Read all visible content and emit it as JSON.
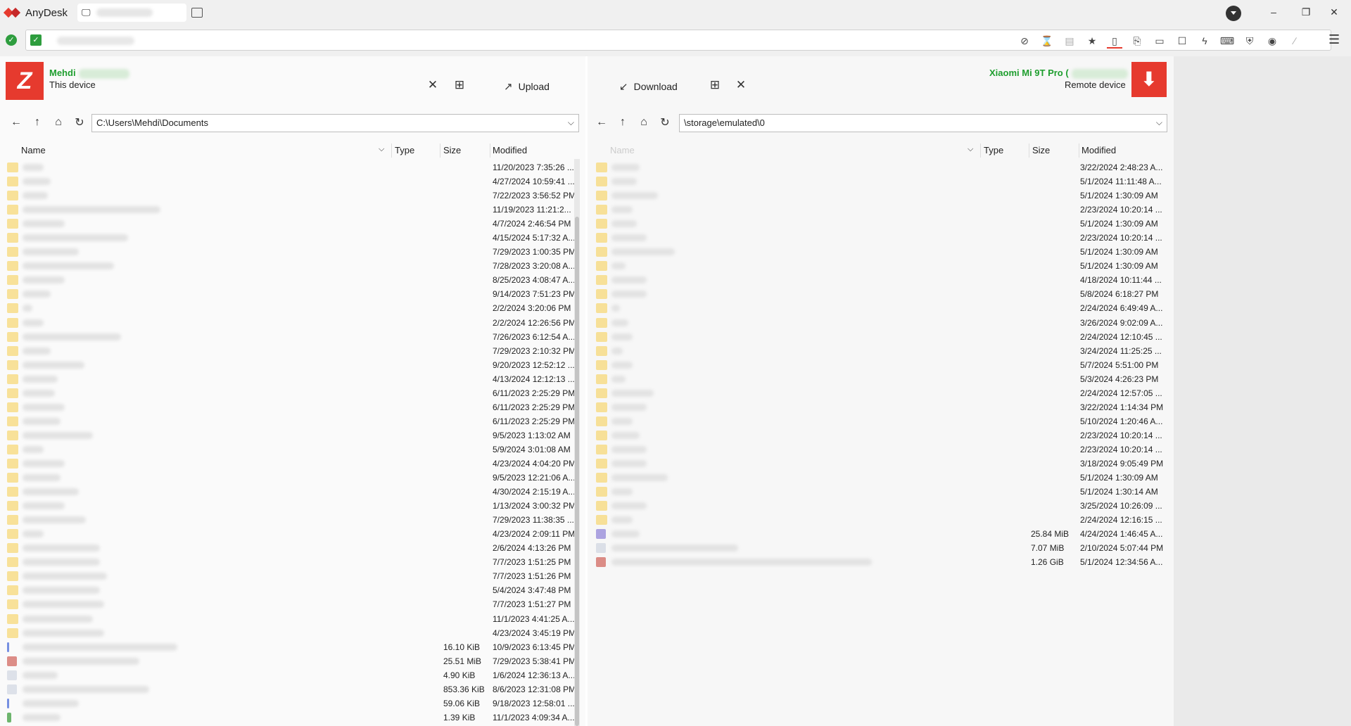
{
  "app": {
    "name": "AnyDesk"
  },
  "toolbar": {
    "icons": [
      "monitor-off-icon",
      "hourglass-icon",
      "database-icon",
      "star-icon",
      "file-transfer-icon",
      "clipboard-icon",
      "display-icon",
      "chat-icon",
      "lightning-icon",
      "keyboard-icon",
      "shield-icon",
      "record-icon",
      "pen-icon"
    ]
  },
  "local": {
    "name": "Mehdi",
    "subtitle": "This device",
    "upload_label": "Upload",
    "path": "C:\\Users\\Mehdi\\Documents",
    "columns": {
      "name": "Name",
      "type": "Type",
      "size": "Size",
      "modified": "Modified"
    },
    "rows": [
      {
        "w": 30,
        "size": "",
        "modified": "11/20/2023 7:35:26 ..."
      },
      {
        "w": 40,
        "size": "",
        "modified": "4/27/2024 10:59:41 ..."
      },
      {
        "w": 36,
        "size": "",
        "modified": "7/22/2023 3:56:52 PM"
      },
      {
        "w": 196,
        "size": "",
        "modified": "11/19/2023 11:21:2..."
      },
      {
        "w": 60,
        "size": "",
        "modified": "4/7/2024 2:46:54 PM"
      },
      {
        "w": 150,
        "size": "",
        "modified": "4/15/2024 5:17:32 A..."
      },
      {
        "w": 80,
        "size": "",
        "modified": "7/29/2023 1:00:35 PM"
      },
      {
        "w": 130,
        "size": "",
        "modified": "7/28/2023 3:20:08 A..."
      },
      {
        "w": 60,
        "size": "",
        "modified": "8/25/2023 4:08:47 A..."
      },
      {
        "w": 40,
        "size": "",
        "modified": "9/14/2023 7:51:23 PM"
      },
      {
        "w": 14,
        "size": "",
        "modified": "2/2/2024 3:20:06 PM"
      },
      {
        "w": 30,
        "size": "",
        "modified": "2/2/2024 12:26:56 PM"
      },
      {
        "w": 140,
        "size": "",
        "modified": "7/26/2023 6:12:54 A..."
      },
      {
        "w": 40,
        "size": "",
        "modified": "7/29/2023 2:10:32 PM"
      },
      {
        "w": 88,
        "size": "",
        "modified": "9/20/2023 12:52:12 ..."
      },
      {
        "w": 50,
        "size": "",
        "modified": "4/13/2024 12:12:13 ..."
      },
      {
        "w": 46,
        "size": "",
        "modified": "6/11/2023 2:25:29 PM"
      },
      {
        "w": 60,
        "size": "",
        "modified": "6/11/2023 2:25:29 PM"
      },
      {
        "w": 54,
        "size": "",
        "modified": "6/11/2023 2:25:29 PM"
      },
      {
        "w": 100,
        "size": "",
        "modified": "9/5/2023 1:13:02 AM"
      },
      {
        "w": 30,
        "size": "",
        "modified": "5/9/2024 3:01:08 AM"
      },
      {
        "w": 60,
        "size": "",
        "modified": "4/23/2024 4:04:20 PM"
      },
      {
        "w": 54,
        "size": "",
        "modified": "9/5/2023 12:21:06 A..."
      },
      {
        "w": 80,
        "size": "",
        "modified": "4/30/2024 2:15:19 A..."
      },
      {
        "w": 60,
        "size": "",
        "modified": "1/13/2024 3:00:32 PM"
      },
      {
        "w": 90,
        "size": "",
        "modified": "7/29/2023 11:38:35 ..."
      },
      {
        "w": 30,
        "size": "",
        "modified": "4/23/2024 2:09:11 PM"
      },
      {
        "w": 110,
        "size": "",
        "modified": "2/6/2024 4:13:26 PM"
      },
      {
        "w": 110,
        "size": "",
        "modified": "7/7/2023 1:51:25 PM"
      },
      {
        "w": 120,
        "size": "",
        "modified": "7/7/2023 1:51:26 PM"
      },
      {
        "w": 110,
        "size": "",
        "modified": "5/4/2024 3:47:48 PM"
      },
      {
        "w": 116,
        "size": "",
        "modified": "7/7/2023 1:51:27 PM"
      },
      {
        "w": 100,
        "size": "",
        "modified": "11/1/2023 4:41:25 A..."
      },
      {
        "w": 116,
        "size": "",
        "modified": "4/23/2024 3:45:19 PM"
      },
      {
        "w": 220,
        "file": "file",
        "size": "16.10 KiB",
        "modified": "10/9/2023 6:13:45 PM"
      },
      {
        "w": 166,
        "file": "red",
        "size": "25.51 MiB",
        "modified": "7/29/2023 5:38:41 PM"
      },
      {
        "w": 50,
        "file": "gray",
        "size": "4.90 KiB",
        "modified": "1/6/2024 12:36:13 A..."
      },
      {
        "w": 180,
        "file": "gray",
        "size": "853.36 KiB",
        "modified": "8/6/2023 12:31:08 PM"
      },
      {
        "w": 80,
        "file": "file",
        "size": "59.06 KiB",
        "modified": "9/18/2023 12:58:01 ..."
      },
      {
        "w": 54,
        "file": "green",
        "size": "1.39 KiB",
        "modified": "11/1/2023 4:09:34 A..."
      }
    ]
  },
  "remote": {
    "name": "Xiaomi Mi 9T Pro (",
    "subtitle": "Remote device",
    "download_label": "Download",
    "path": "\\storage\\emulated\\0",
    "columns": {
      "name": "Name",
      "type": "Type",
      "size": "Size",
      "modified": "Modified"
    },
    "rows": [
      {
        "w": 40,
        "size": "",
        "modified": "3/22/2024 2:48:23 A..."
      },
      {
        "w": 36,
        "size": "",
        "modified": "5/1/2024 11:11:48 A..."
      },
      {
        "w": 66,
        "size": "",
        "modified": "5/1/2024 1:30:09 AM"
      },
      {
        "w": 30,
        "size": "",
        "modified": "2/23/2024 10:20:14 ..."
      },
      {
        "w": 36,
        "size": "",
        "modified": "5/1/2024 1:30:09 AM"
      },
      {
        "w": 50,
        "size": "",
        "modified": "2/23/2024 10:20:14 ..."
      },
      {
        "w": 90,
        "size": "",
        "modified": "5/1/2024 1:30:09 AM"
      },
      {
        "w": 20,
        "size": "",
        "modified": "5/1/2024 1:30:09 AM"
      },
      {
        "w": 50,
        "size": "",
        "modified": "4/18/2024 10:11:44 ..."
      },
      {
        "w": 50,
        "size": "",
        "modified": "5/8/2024 6:18:27 PM"
      },
      {
        "w": 12,
        "size": "",
        "modified": "2/24/2024 6:49:49 A..."
      },
      {
        "w": 24,
        "size": "",
        "modified": "3/26/2024 9:02:09 A..."
      },
      {
        "w": 30,
        "size": "",
        "modified": "2/24/2024 12:10:45 ..."
      },
      {
        "w": 16,
        "size": "",
        "modified": "3/24/2024 11:25:25 ..."
      },
      {
        "w": 30,
        "size": "",
        "modified": "5/7/2024 5:51:00 PM"
      },
      {
        "w": 20,
        "size": "",
        "modified": "5/3/2024 4:26:23 PM"
      },
      {
        "w": 60,
        "size": "",
        "modified": "2/24/2024 12:57:05 ..."
      },
      {
        "w": 50,
        "size": "",
        "modified": "3/22/2024 1:14:34 PM"
      },
      {
        "w": 30,
        "size": "",
        "modified": "5/10/2024 1:20:46 A..."
      },
      {
        "w": 40,
        "size": "",
        "modified": "2/23/2024 10:20:14 ..."
      },
      {
        "w": 50,
        "size": "",
        "modified": "2/23/2024 10:20:14 ..."
      },
      {
        "w": 50,
        "size": "",
        "modified": "3/18/2024 9:05:49 PM"
      },
      {
        "w": 80,
        "size": "",
        "modified": "5/1/2024 1:30:09 AM"
      },
      {
        "w": 30,
        "size": "",
        "modified": "5/1/2024 1:30:14 AM"
      },
      {
        "w": 50,
        "size": "",
        "modified": "3/25/2024 10:26:09 ..."
      },
      {
        "w": 30,
        "size": "",
        "modified": "2/24/2024 12:16:15 ..."
      },
      {
        "w": 40,
        "file": "purple",
        "size": "25.84 MiB",
        "modified": "4/24/2024 1:46:45 A..."
      },
      {
        "w": 180,
        "file": "gray",
        "size": "7.07 MiB",
        "modified": "2/10/2024 5:07:44 PM"
      },
      {
        "w": 370,
        "file": "red",
        "size": "1.26 GiB",
        "modified": "5/1/2024 12:34:56 A..."
      }
    ]
  },
  "colors": {
    "accent": "#e63a2e",
    "online": "#1e9e2e"
  }
}
